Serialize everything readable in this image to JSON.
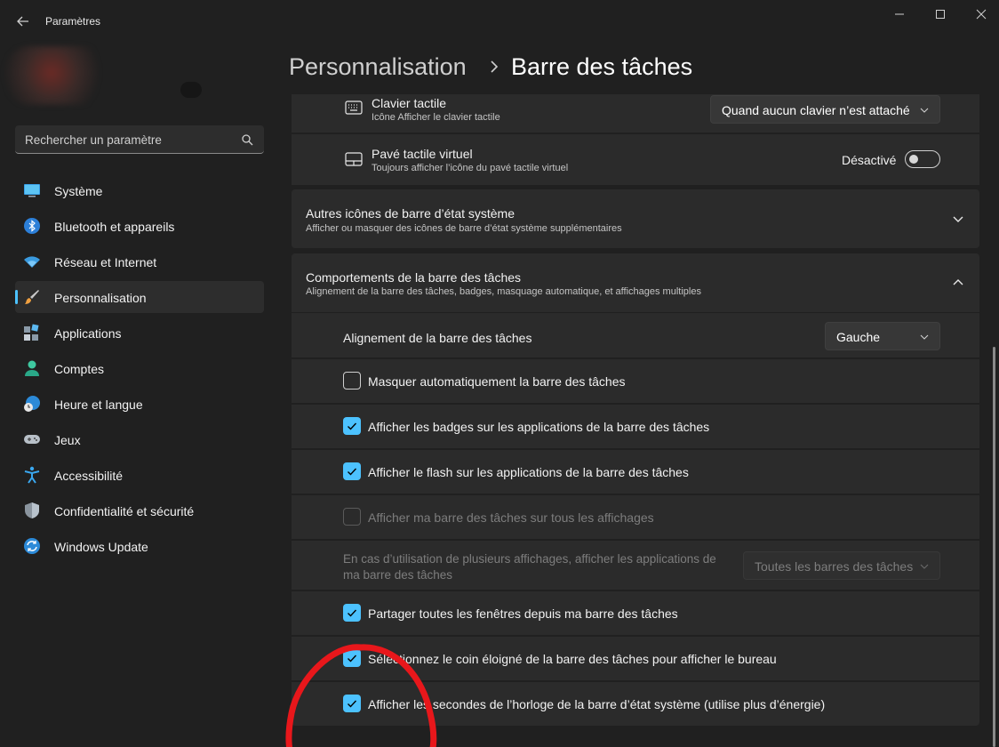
{
  "window": {
    "title": "Paramètres",
    "controls": [
      "minimize-icon",
      "maximize-icon",
      "close-icon"
    ]
  },
  "search": {
    "placeholder": "Rechercher un paramètre"
  },
  "sidebar": {
    "items": [
      {
        "label": "Système",
        "icon": "monitor-icon"
      },
      {
        "label": "Bluetooth et appareils",
        "icon": "bluetooth-icon"
      },
      {
        "label": "Réseau et Internet",
        "icon": "wifi-icon"
      },
      {
        "label": "Personnalisation",
        "icon": "brush-icon",
        "active": true
      },
      {
        "label": "Applications",
        "icon": "apps-icon"
      },
      {
        "label": "Comptes",
        "icon": "person-icon"
      },
      {
        "label": "Heure et langue",
        "icon": "globe-clock-icon"
      },
      {
        "label": "Jeux",
        "icon": "gamepad-icon"
      },
      {
        "label": "Accessibilité",
        "icon": "accessibility-icon"
      },
      {
        "label": "Confidentialité et sécurité",
        "icon": "shield-icon"
      },
      {
        "label": "Windows Update",
        "icon": "update-icon"
      }
    ]
  },
  "breadcrumb": {
    "root": "Personnalisation",
    "separator": "›",
    "current": "Barre des tâches"
  },
  "touch_keyboard": {
    "title": "Clavier tactile",
    "subtitle": "Icône Afficher le clavier tactile",
    "value": "Quand aucun clavier n’est attaché"
  },
  "touchpad": {
    "title": "Pavé tactile virtuel",
    "subtitle": "Toujours afficher l’icône du pavé tactile virtuel",
    "state": "Désactivé"
  },
  "other_icons": {
    "title": "Autres icônes de barre d’état système",
    "subtitle": "Afficher ou masquer des icônes de barre d’état système supplémentaires"
  },
  "behaviors": {
    "title": "Comportements de la barre des tâches",
    "subtitle": "Alignement de la barre des tâches, badges, masquage automatique, et affichages multiples",
    "alignment_label": "Alignement de la barre des tâches",
    "alignment_value": "Gauche",
    "options": [
      {
        "label": "Masquer automatiquement la barre des tâches",
        "checked": false,
        "enabled": true
      },
      {
        "label": "Afficher les badges sur les applications de la barre des tâches",
        "checked": true,
        "enabled": true
      },
      {
        "label": "Afficher le flash sur les applications de la barre des tâches",
        "checked": true,
        "enabled": true
      },
      {
        "label": "Afficher ma barre des tâches sur tous les affichages",
        "checked": false,
        "enabled": false
      }
    ],
    "multi_display_line1": "En cas d’utilisation de plusieurs affichages, afficher les applications de",
    "multi_display_line2": "ma barre des tâches",
    "multi_display_value": "Toutes les barres des tâches",
    "more_options": [
      {
        "label": "Partager toutes les fenêtres depuis ma barre des tâches",
        "checked": true
      },
      {
        "label": "Sélectionnez le coin éloigné de la barre des tâches pour afficher le bureau",
        "checked": true
      },
      {
        "label": "Afficher les secondes de l’horloge de la barre d’état système (utilise plus d’énergie)",
        "checked": true
      }
    ]
  },
  "colors": {
    "accent": "#4cc2ff",
    "background": "#202020",
    "card": "#2b2b2b",
    "annotation": "#e8171b"
  }
}
